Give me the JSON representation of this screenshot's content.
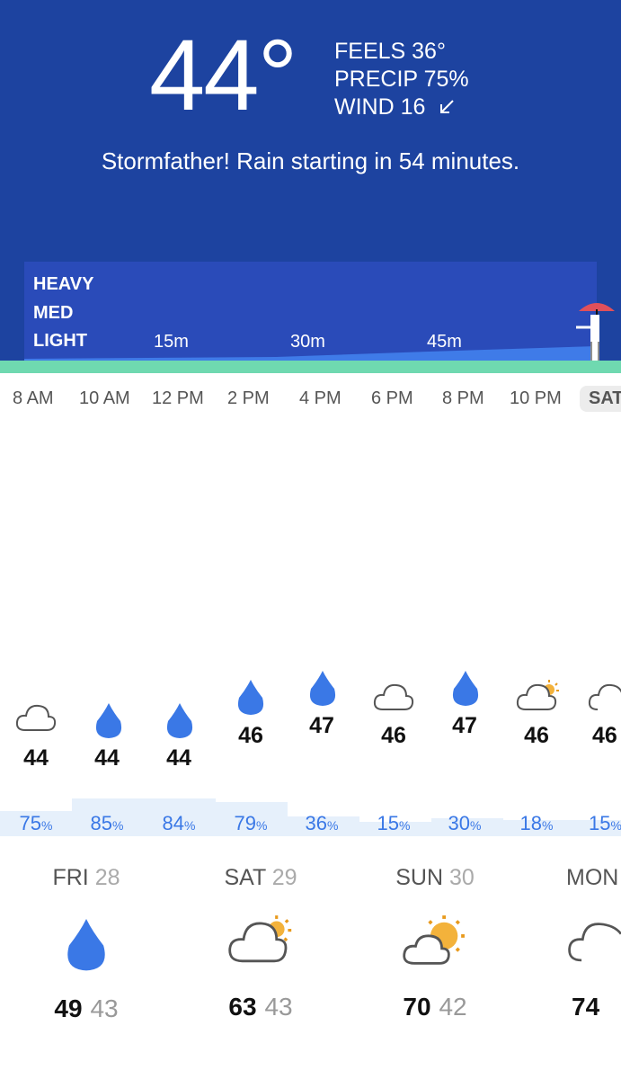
{
  "current": {
    "temp": "44°",
    "feels": "FEELS 36°",
    "precip": "PRECIP 75%",
    "wind": "WIND 16",
    "message": "Stormfather! Rain starting in 54 minutes."
  },
  "rain_chart": {
    "levels": [
      "HEAVY",
      "MED",
      "LIGHT"
    ],
    "ticks": [
      "15m",
      "30m",
      "45m"
    ]
  },
  "hours": [
    "8 AM",
    "10 AM",
    "12 PM",
    "2 PM",
    "4 PM",
    "6 PM",
    "8 PM",
    "10 PM",
    "SAT"
  ],
  "hourly": [
    {
      "icon": "cloud-icon",
      "temp": "44",
      "precip": "75"
    },
    {
      "icon": "raindrop-icon",
      "temp": "44",
      "precip": "85"
    },
    {
      "icon": "raindrop-icon",
      "temp": "44",
      "precip": "84"
    },
    {
      "icon": "raindrop-icon",
      "temp": "46",
      "precip": "79"
    },
    {
      "icon": "raindrop-icon",
      "temp": "47",
      "precip": "36"
    },
    {
      "icon": "cloud-icon",
      "temp": "46",
      "precip": "15"
    },
    {
      "icon": "raindrop-icon",
      "temp": "47",
      "precip": "30"
    },
    {
      "icon": "partly-cloudy-icon",
      "temp": "46",
      "precip": "18"
    },
    {
      "icon": "cloud-icon",
      "temp": "46",
      "precip": "15"
    }
  ],
  "pct_unit": "%",
  "daily": [
    {
      "day": "FRI",
      "date": "28",
      "icon": "raindrop-icon",
      "high": "49",
      "low": "43"
    },
    {
      "day": "SAT",
      "date": "29",
      "icon": "partly-cloudy-icon",
      "high": "63",
      "low": "43"
    },
    {
      "day": "SUN",
      "date": "30",
      "icon": "partly-sunny-icon",
      "high": "70",
      "low": "42"
    },
    {
      "day": "MON",
      "date": "",
      "icon": "cloud-icon",
      "high": "74",
      "low": ""
    }
  ],
  "colors": {
    "header_bg": "#1d43a0",
    "rain_box": "#2a4bb9",
    "ground": "#6fd9b0",
    "accent_blue": "#3a78e6",
    "umbrella": "#e0505a"
  }
}
